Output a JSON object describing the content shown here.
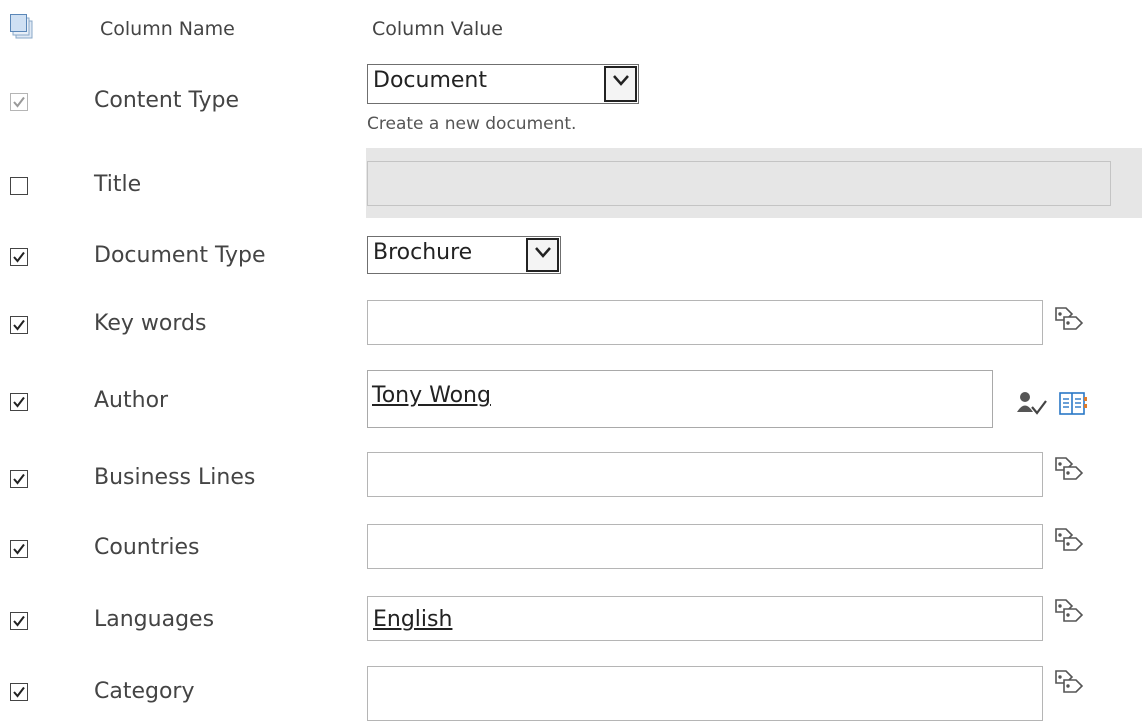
{
  "header": {
    "column_name": "Column Name",
    "column_value": "Column Value"
  },
  "rows": {
    "content_type": {
      "label": "Content Type",
      "checked": true,
      "enabled": false,
      "value": "Document",
      "hint": "Create a new document."
    },
    "title": {
      "label": "Title",
      "checked": false,
      "value": ""
    },
    "document_type": {
      "label": "Document Type",
      "checked": true,
      "value": "Brochure"
    },
    "key_words": {
      "label": "Key words",
      "checked": true,
      "value": ""
    },
    "author": {
      "label": "Author",
      "checked": true,
      "value": "Tony Wong"
    },
    "business_lines": {
      "label": "Business Lines",
      "checked": true,
      "value": ""
    },
    "countries": {
      "label": "Countries",
      "checked": true,
      "value": ""
    },
    "languages": {
      "label": "Languages",
      "checked": true,
      "value": "English"
    },
    "category": {
      "label": "Category",
      "checked": true,
      "value": ""
    }
  },
  "icons": {
    "select_all": "select-all-icon",
    "browse_terms": "tag-browse-icon",
    "check_names": "check-names-icon",
    "browse_people": "address-book-icon"
  },
  "colors": {
    "text": "#444444",
    "input_border": "#b5b5b5",
    "disabled_field": "#e6e6e6",
    "accent_blue": "#2a78c6"
  }
}
